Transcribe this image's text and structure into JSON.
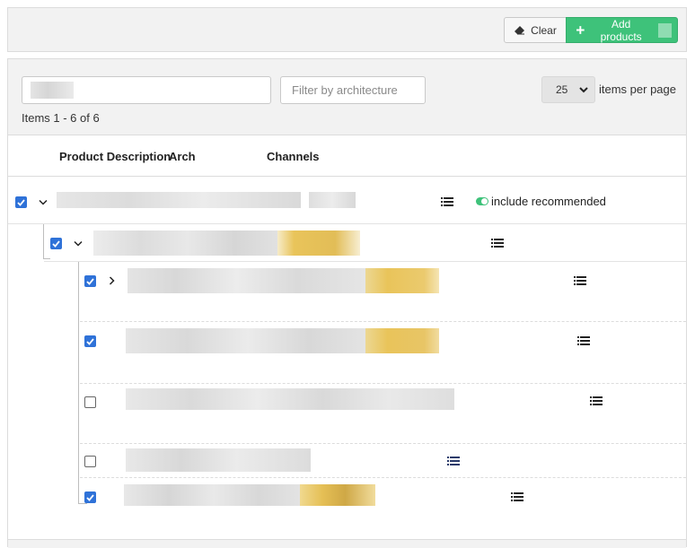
{
  "toolbar": {
    "clear_label": "Clear",
    "add_label": "Add products",
    "eraser_icon": "eraser-icon",
    "plus_icon": "plus-icon"
  },
  "filters": {
    "search_value": "",
    "arch_placeholder": "Filter by architecture",
    "page_size": "25",
    "per_page_label": "items per page",
    "items_count": "Items 1 - 6 of 6"
  },
  "columns": {
    "product_description": "Product Description",
    "arch": "Arch",
    "channels": "Channels"
  },
  "rows": [
    {
      "checked": true,
      "expander": "down",
      "recommended_label": "include recommended"
    },
    {
      "checked": true,
      "expander": "down"
    },
    {
      "checked": true,
      "expander": "right"
    },
    {
      "checked": true
    },
    {
      "checked": false
    },
    {
      "checked": false
    },
    {
      "checked": true
    }
  ],
  "colors": {
    "accent_green": "#3ec27a",
    "checkbox_blue": "#2f72d8",
    "highlight_yellow": "#e9c45a"
  }
}
